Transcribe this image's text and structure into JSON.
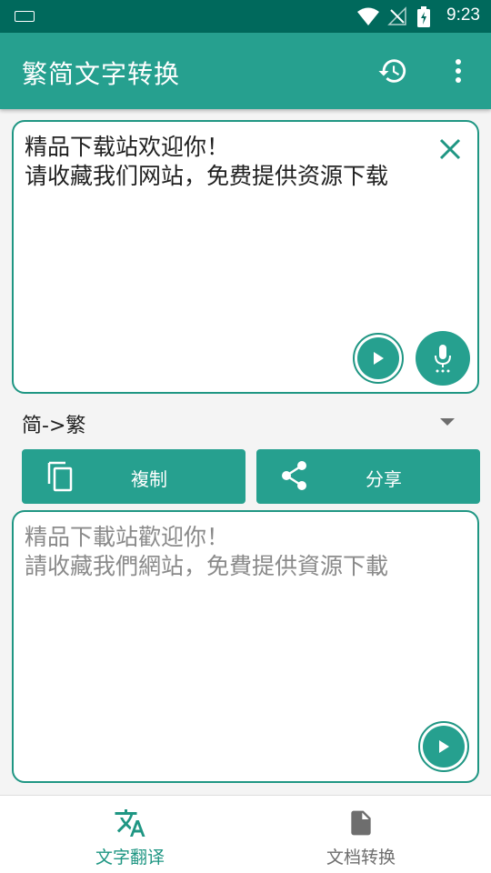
{
  "status_bar": {
    "time": "9:23"
  },
  "app_bar": {
    "title": "繁简文字转换"
  },
  "input_card": {
    "text": "精品下载站欢迎你！\n请收藏我们网站，免费提供资源下载"
  },
  "mode_selector": {
    "selected": "简->繁"
  },
  "actions": {
    "copy_label": "複制",
    "share_label": "分享"
  },
  "output_card": {
    "text": "精品下載站歡迎你！\n請收藏我們網站，免費提供資源下載"
  },
  "bottom_nav": {
    "items": [
      {
        "label": "文字翻译",
        "icon": "translate-icon",
        "active": true
      },
      {
        "label": "文档转换",
        "icon": "document-icon",
        "active": false
      }
    ]
  },
  "colors": {
    "primary": "#26a08f",
    "primary_dark": "#00695c",
    "accent_border": "#1f9683"
  }
}
